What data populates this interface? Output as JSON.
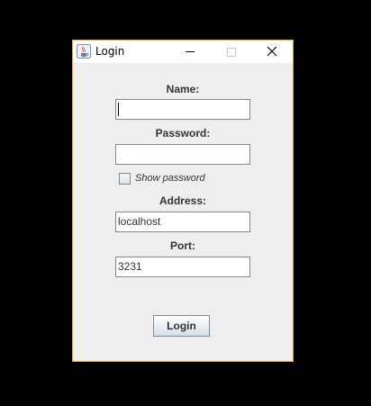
{
  "window": {
    "title": "Login",
    "app_icon": "java-cup-icon",
    "controls": {
      "minimize": "minimize-icon",
      "maximize": "maximize-icon",
      "close": "✕"
    },
    "border_color": "#e8a33d"
  },
  "form": {
    "name_label": "Name:",
    "name_value": "",
    "password_label": "Password:",
    "password_value": "",
    "show_password_label": "Show password",
    "show_password_checked": false,
    "address_label": "Address:",
    "address_value": "localhost",
    "port_label": "Port:",
    "port_value": "3231",
    "login_label": "Login"
  }
}
